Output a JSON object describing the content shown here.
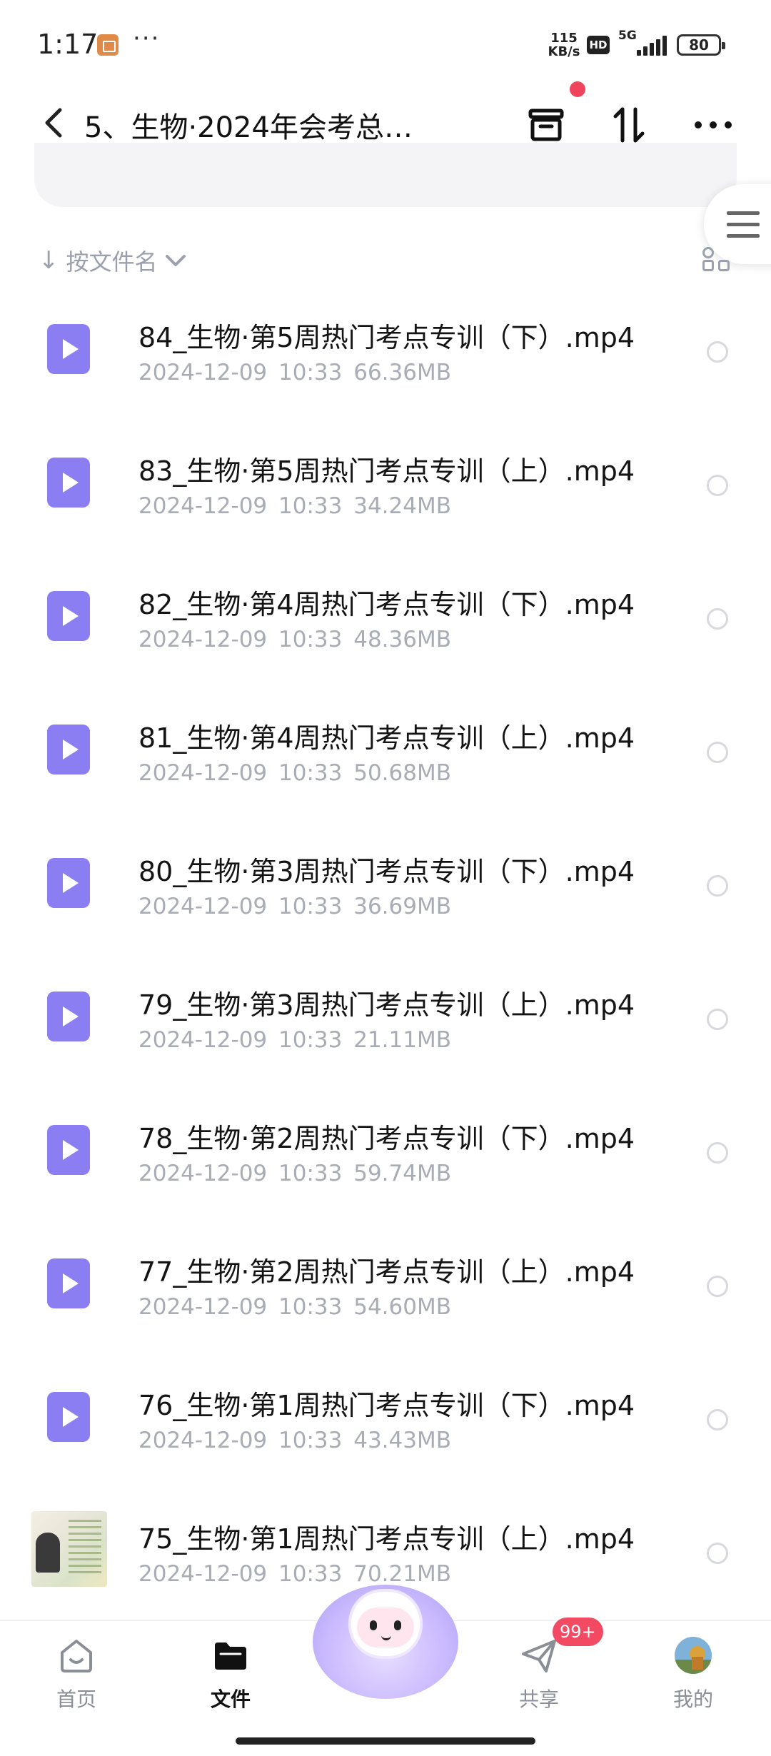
{
  "status_bar": {
    "time": "1:17",
    "more": "···",
    "speed_value": "115",
    "speed_unit": "KB/s",
    "hd": "HD",
    "network": "5G",
    "battery": "80"
  },
  "header": {
    "title": "5、生物·2024年会考总…"
  },
  "sort": {
    "label": "按文件名"
  },
  "files": [
    {
      "name": "84_生物·第5周热门考点专训（下）.mp4",
      "date": "2024-12-09",
      "time": "10:33",
      "size": "66.36MB"
    },
    {
      "name": "83_生物·第5周热门考点专训（上）.mp4",
      "date": "2024-12-09",
      "time": "10:33",
      "size": "34.24MB"
    },
    {
      "name": "82_生物·第4周热门考点专训（下）.mp4",
      "date": "2024-12-09",
      "time": "10:33",
      "size": "48.36MB"
    },
    {
      "name": "81_生物·第4周热门考点专训（上）.mp4",
      "date": "2024-12-09",
      "time": "10:33",
      "size": "50.68MB"
    },
    {
      "name": "80_生物·第3周热门考点专训（下）.mp4",
      "date": "2024-12-09",
      "time": "10:33",
      "size": "36.69MB"
    },
    {
      "name": "79_生物·第3周热门考点专训（上）.mp4",
      "date": "2024-12-09",
      "time": "10:33",
      "size": "21.11MB"
    },
    {
      "name": "78_生物·第2周热门考点专训（下）.mp4",
      "date": "2024-12-09",
      "time": "10:33",
      "size": "59.74MB"
    },
    {
      "name": "77_生物·第2周热门考点专训（上）.mp4",
      "date": "2024-12-09",
      "time": "10:33",
      "size": "54.60MB"
    },
    {
      "name": "76_生物·第1周热门考点专训（下）.mp4",
      "date": "2024-12-09",
      "time": "10:33",
      "size": "43.43MB"
    },
    {
      "name": "75_生物·第1周热门考点专训（上）.mp4",
      "date": "2024-12-09",
      "time": "10:33",
      "size": "70.21MB"
    }
  ],
  "bottom_nav": {
    "home": "首页",
    "files": "文件",
    "share": "共享",
    "share_badge": "99+",
    "mine": "我的"
  },
  "colors": {
    "accent": "#8b7ef2",
    "badge": "#f24a62"
  }
}
